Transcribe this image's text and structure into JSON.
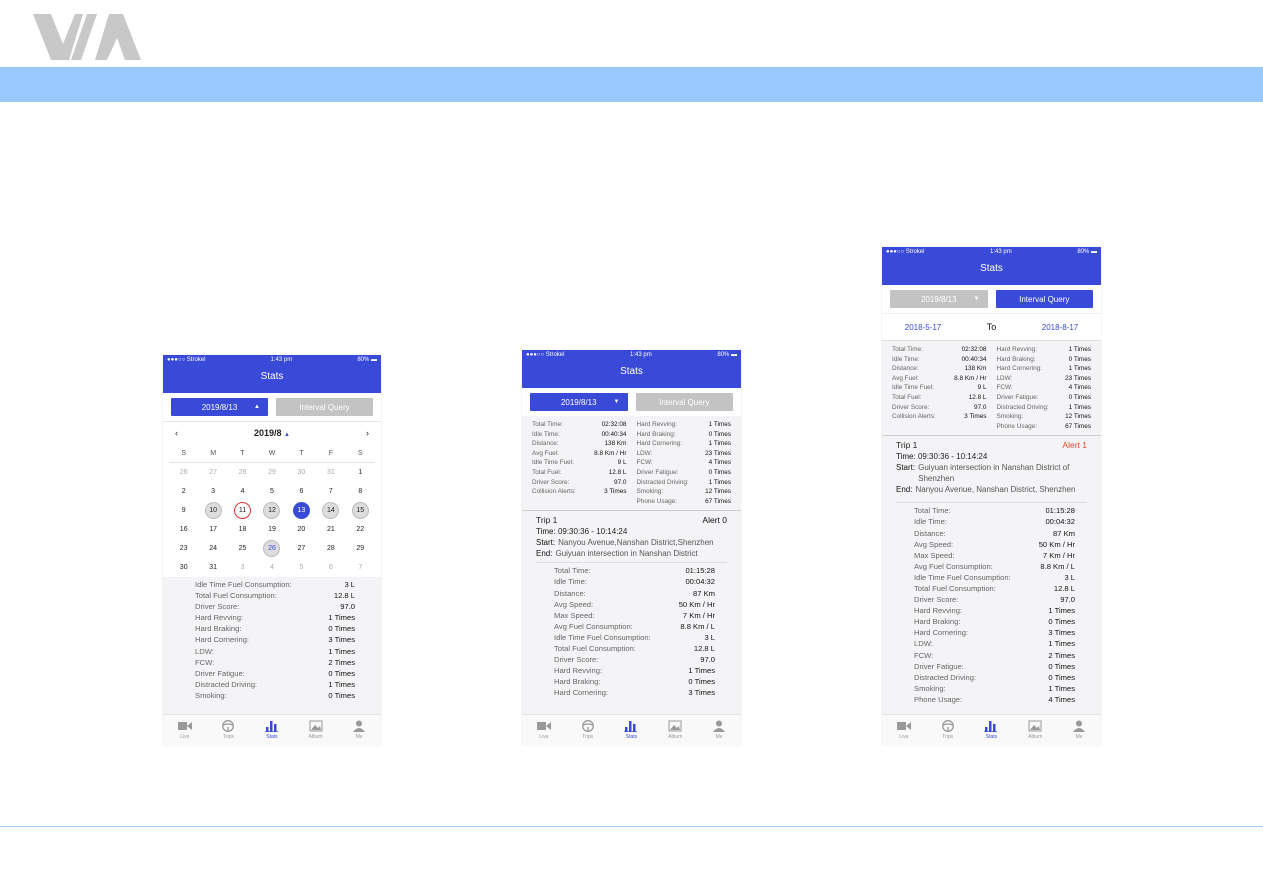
{
  "brand": {
    "logo_text": "VIA",
    "band_color": "#99c9fc",
    "accent": "#3a4ad8",
    "alert_color": "#e5472b"
  },
  "common": {
    "status": {
      "carrier": "●●●○○ Strokel",
      "time": "1:43 pm",
      "battery": "80%"
    },
    "title": "Stats",
    "interval_label": "Interval Query",
    "tabs": [
      {
        "label": "Live",
        "icon": "video-camera-icon"
      },
      {
        "label": "Trips",
        "icon": "steering-wheel-icon"
      },
      {
        "label": "Stats",
        "icon": "bar-chart-icon",
        "active": true
      },
      {
        "label": "Album",
        "icon": "image-icon"
      },
      {
        "label": "Me",
        "icon": "person-icon"
      }
    ]
  },
  "phone1": {
    "date": "2019/8/13",
    "calendar": {
      "month": "2019/8",
      "weekdays": [
        "S",
        "M",
        "T",
        "W",
        "T",
        "F",
        "S"
      ],
      "days": [
        [
          "26",
          "27",
          "28",
          "29",
          "30",
          "31",
          "1"
        ],
        [
          "2",
          "3",
          "4",
          "5",
          "6",
          "7",
          "8"
        ],
        [
          "9",
          "10",
          "11",
          "12",
          "13",
          "14",
          "15"
        ],
        [
          "16",
          "17",
          "18",
          "19",
          "20",
          "21",
          "22"
        ],
        [
          "23",
          "24",
          "25",
          "26",
          "27",
          "28",
          "29"
        ],
        [
          "30",
          "31",
          "3",
          "4",
          "5",
          "6",
          "7"
        ]
      ],
      "selected": "13",
      "alert_day": "11",
      "recorded": [
        "10",
        "12",
        "14",
        "15",
        "26"
      ]
    },
    "stats": [
      [
        "Idle Time Fuel Consumption:",
        "3 L"
      ],
      [
        "Total Fuel Consumption:",
        "12.8 L"
      ],
      [
        "Driver Score:",
        "97.0"
      ],
      [
        "Hard Revving:",
        "1 Times"
      ],
      [
        "Hard Braking:",
        "0 Times"
      ],
      [
        "Hard Cornering:",
        "3 Times"
      ],
      [
        "LDW:",
        "1 Times"
      ],
      [
        "FCW:",
        "2 Times"
      ],
      [
        "Driver Fatigue:",
        "0 Times"
      ],
      [
        "Distracted Driving:",
        "1 Times"
      ],
      [
        "Smoking:",
        "0 Times"
      ]
    ]
  },
  "phone2": {
    "date": "2019/8/13",
    "summary_left": [
      [
        "Total Time:",
        "02:32:08"
      ],
      [
        "Idle Time:",
        "00:40:34"
      ],
      [
        "Distance:",
        "138 Km"
      ],
      [
        "Avg Fuel:",
        "8.8 Km / Hr"
      ],
      [
        "Idle Time Fuel:",
        "9 L"
      ],
      [
        "Total Fuel:",
        "12.8 L"
      ],
      [
        "Driver Score:",
        "97.0"
      ],
      [
        "Collision Alerts:",
        "3 Times"
      ]
    ],
    "summary_right": [
      [
        "Hard Revving:",
        "1 Times"
      ],
      [
        "Hard Braking:",
        "0 Times"
      ],
      [
        "Hard Cornering:",
        "1 Times"
      ],
      [
        "LDW:",
        "23 Times"
      ],
      [
        "FCW:",
        "4 Times"
      ],
      [
        "Driver Fatigue:",
        "0 Times"
      ],
      [
        "Distracted Driving:",
        "1 Times"
      ],
      [
        "Smoking:",
        "12 Times"
      ],
      [
        "Phone Usage:",
        "67 Times"
      ]
    ],
    "trip": {
      "name": "Trip 1",
      "alert": "Alert 0",
      "time_label": "Time:",
      "time": "09:30:36 - 10:14:24",
      "start_label": "Start:",
      "start": "Nanyou Avenue,Nanshan District,Shenzhen",
      "end_label": "End:",
      "end": "Guiyuan intersection in Nanshan District"
    },
    "stats": [
      [
        "Total Time:",
        "01:15:28"
      ],
      [
        "Idle Time:",
        "00:04:32"
      ],
      [
        "Distance:",
        "87 Km"
      ],
      [
        "Avg Speed:",
        "50 Km / Hr"
      ],
      [
        "Max Speed:",
        "7 Km / Hr"
      ],
      [
        "Avg Fuel Consumption:",
        "8.8 Km / L"
      ],
      [
        "Idle Time Fuel Consumption:",
        "3 L"
      ],
      [
        "Total Fuel Consumption:",
        "12.8 L"
      ],
      [
        "Driver Score:",
        "97.0"
      ],
      [
        "Hard Revving:",
        "1 Times"
      ],
      [
        "Hard Braking:",
        "0 Times"
      ],
      [
        "Hard Cornering:",
        "3 Times"
      ]
    ]
  },
  "phone3": {
    "date": "2019/8/13",
    "range": {
      "from": "2018-5-17",
      "to_label": "To",
      "to": "2018-8-17"
    },
    "summary_left": [
      [
        "Total Time:",
        "02:32:08"
      ],
      [
        "Idle Time:",
        "00:40:34"
      ],
      [
        "Distance:",
        "138 Km"
      ],
      [
        "Avg Fuel:",
        "8.8 Km / Hr"
      ],
      [
        "Idle Time Fuel:",
        "9 L"
      ],
      [
        "Total Fuel:",
        "12.8 L"
      ],
      [
        "Driver Score:",
        "97.0"
      ],
      [
        "Collision Alerts:",
        "3 Times"
      ]
    ],
    "summary_right": [
      [
        "Hard Revving:",
        "1 Times"
      ],
      [
        "Hard Braking:",
        "0 Times"
      ],
      [
        "Hard Cornering:",
        "1 Times"
      ],
      [
        "LDW:",
        "23 Times"
      ],
      [
        "FCW:",
        "4 Times"
      ],
      [
        "Driver Fatigue:",
        "0 Times"
      ],
      [
        "Distracted Driving:",
        "1 Times"
      ],
      [
        "Smoking:",
        "12 Times"
      ],
      [
        "Phone Usage:",
        "67 Times"
      ]
    ],
    "trip": {
      "name": "Trip 1",
      "alert": "Alert 1",
      "time_label": "Time:",
      "time": "09:30:36 - 10:14:24",
      "start_label": "Start:",
      "start": "Guiyuan intersection in Nanshan District of Shenzhen",
      "end_label": "End:",
      "end": "Nanyou Avenue, Nanshan District, Shenzhen"
    },
    "stats": [
      [
        "Total Time:",
        "01:15:28"
      ],
      [
        "Idle Time:",
        "00:04:32"
      ],
      [
        "Distance:",
        "87 Km"
      ],
      [
        "Avg Speed:",
        "50 Km / Hr"
      ],
      [
        "Max Speed:",
        "7 Km / Hr"
      ],
      [
        "Avg Fuel Consumption:",
        "8.8 Km / L"
      ],
      [
        "Idle Time Fuel Consumption:",
        "3 L"
      ],
      [
        "Total Fuel Consumption:",
        "12.8 L"
      ],
      [
        "Driver Score:",
        "97.0"
      ],
      [
        "Hard Revving:",
        "1 Times"
      ],
      [
        "Hard Braking:",
        "0 Times"
      ],
      [
        "Hard Cornering:",
        "3 Times"
      ],
      [
        "LDW:",
        "1 Times"
      ],
      [
        "FCW:",
        "2 Times"
      ],
      [
        "Driver Fatigue:",
        "0 Times"
      ],
      [
        "Distracted Driving:",
        "0 Times"
      ],
      [
        "Smoking:",
        "1 Times"
      ],
      [
        "Phone Usage:",
        "4 Times"
      ]
    ]
  }
}
